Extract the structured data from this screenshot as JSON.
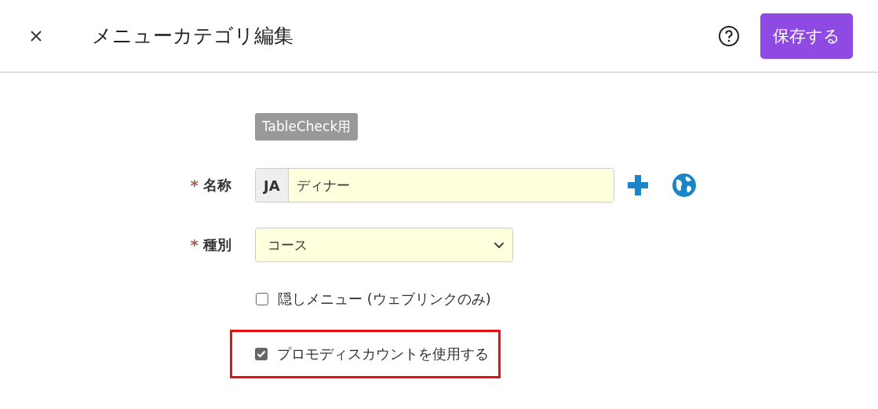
{
  "header": {
    "title": "メニューカテゴリ編集",
    "save_button": "保存する"
  },
  "badge": "TableCheck用",
  "fields": [
    {
      "kind": "text",
      "label": "名称",
      "required_mark": "*",
      "language": "JA",
      "value": "ディナー"
    },
    {
      "kind": "select",
      "label": "種別",
      "required_mark": "*",
      "value": "コース"
    }
  ],
  "checkboxes": [
    {
      "label": "隠しメニュー (ウェブリンクのみ)",
      "checked": false,
      "highlighted": false
    },
    {
      "label": "プロモディスカウントを使用する",
      "checked": true,
      "highlighted": true
    }
  ]
}
